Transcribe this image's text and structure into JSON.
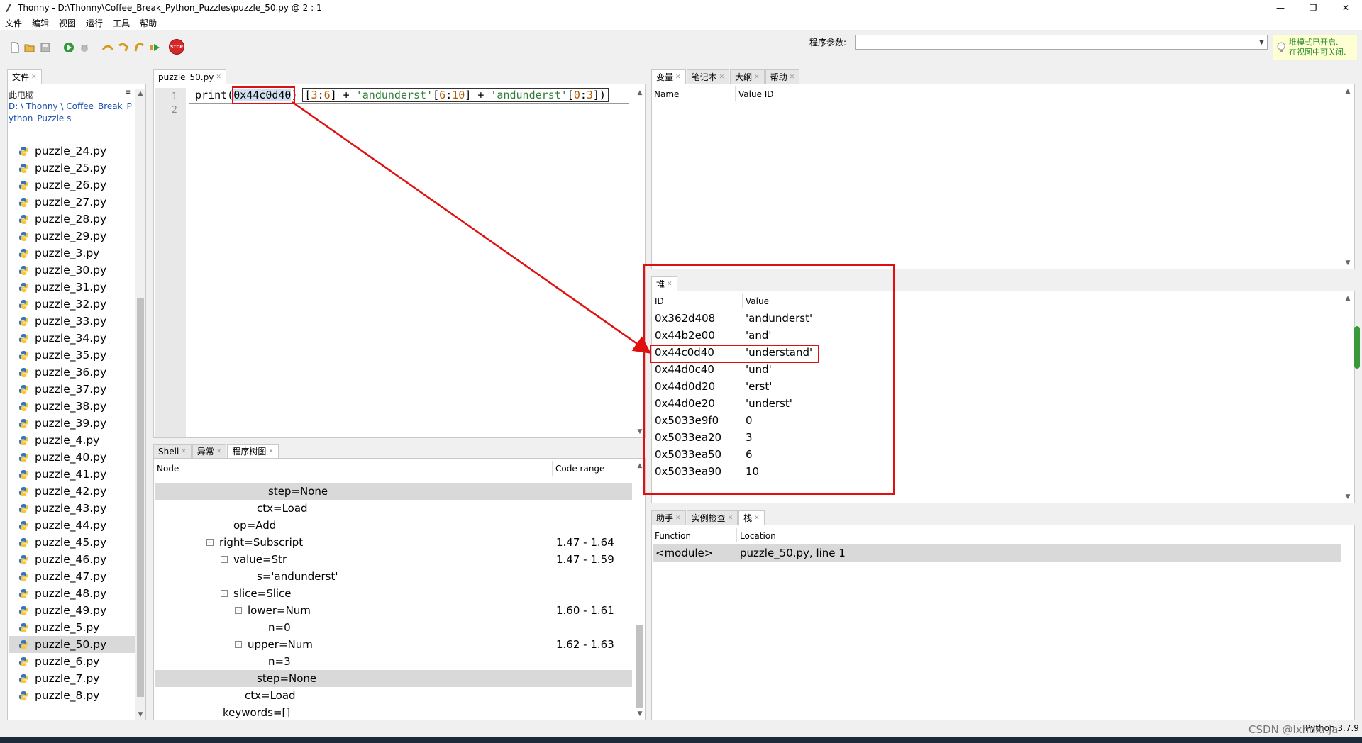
{
  "window": {
    "title": "Thonny  -  D:\\Thonny\\Coffee_Break_Python_Puzzles\\puzzle_50.py  @  2 : 1",
    "min": "—",
    "max": "❐",
    "close": "✕"
  },
  "menu": [
    "文件",
    "编辑",
    "视图",
    "运行",
    "工具",
    "帮助"
  ],
  "toolbar": {
    "args_label": "程序参数:",
    "args_value": "",
    "stop_label": "STOP",
    "notice": "堆模式已开启.\n在视图中可关闭."
  },
  "files": {
    "tab": "文件",
    "pc": "此电脑",
    "path": "D: \\ Thonny \\ Coffee_Break_Python_Puzzle s",
    "items": [
      "puzzle_24.py",
      "puzzle_25.py",
      "puzzle_26.py",
      "puzzle_27.py",
      "puzzle_28.py",
      "puzzle_29.py",
      "puzzle_3.py",
      "puzzle_30.py",
      "puzzle_31.py",
      "puzzle_32.py",
      "puzzle_33.py",
      "puzzle_34.py",
      "puzzle_35.py",
      "puzzle_36.py",
      "puzzle_37.py",
      "puzzle_38.py",
      "puzzle_39.py",
      "puzzle_4.py",
      "puzzle_40.py",
      "puzzle_41.py",
      "puzzle_42.py",
      "puzzle_43.py",
      "puzzle_44.py",
      "puzzle_45.py",
      "puzzle_46.py",
      "puzzle_47.py",
      "puzzle_48.py",
      "puzzle_49.py",
      "puzzle_5.py",
      "puzzle_50.py",
      "puzzle_6.py",
      "puzzle_7.py",
      "puzzle_8.py"
    ],
    "selected": "puzzle_50.py"
  },
  "editor": {
    "tab": "puzzle_50.py",
    "line_numbers": [
      "1",
      "2"
    ],
    "code": {
      "print_open": "print(",
      "highlight": "0x44c0d40",
      "close_paren": ")",
      "rest_1": "[3:6] + 'andunderst'[6:10] + 'andunderst'[0:3])"
    }
  },
  "bottom_tabs": [
    "Shell",
    "异常",
    "程序树图"
  ],
  "tree": {
    "col_node": "Node",
    "col_range": "Code range",
    "rows": [
      {
        "text": "step=None",
        "indent": 160,
        "range": "",
        "toggle": "",
        "gray": true
      },
      {
        "text": "ctx=Load",
        "indent": 144,
        "range": "",
        "toggle": "",
        "gray": false
      },
      {
        "text": "op=Add",
        "indent": 111,
        "range": "",
        "toggle": "",
        "gray": false
      },
      {
        "text": "right=Subscript",
        "indent": 93,
        "range": "1.47  -  1.64",
        "toggle": "⊟",
        "gray": false
      },
      {
        "text": "value=Str",
        "indent": 113,
        "range": "1.47  -  1.59",
        "toggle": "⊟",
        "gray": false
      },
      {
        "text": "s='andunderst'",
        "indent": 144,
        "range": "",
        "toggle": "",
        "gray": false
      },
      {
        "text": "slice=Slice",
        "indent": 113,
        "range": "",
        "toggle": "⊟",
        "gray": false
      },
      {
        "text": "lower=Num",
        "indent": 133,
        "range": "1.60  -  1.61",
        "toggle": "⊟",
        "gray": false
      },
      {
        "text": "n=0",
        "indent": 160,
        "range": "",
        "toggle": "",
        "gray": false
      },
      {
        "text": "upper=Num",
        "indent": 133,
        "range": "1.62  -  1.63",
        "toggle": "⊟",
        "gray": false
      },
      {
        "text": "n=3",
        "indent": 160,
        "range": "",
        "toggle": "",
        "gray": false
      },
      {
        "text": "step=None",
        "indent": 144,
        "range": "",
        "toggle": "",
        "gray": true
      },
      {
        "text": "ctx=Load",
        "indent": 127,
        "range": "",
        "toggle": "",
        "gray": false
      },
      {
        "text": "keywords=[]",
        "indent": 96,
        "range": "",
        "toggle": "",
        "gray": false
      }
    ]
  },
  "vars": {
    "tabs": [
      "变量",
      "笔记本",
      "大纲",
      "帮助"
    ],
    "col_name": "Name",
    "col_id": "Value ID"
  },
  "heap": {
    "tab": "堆",
    "col_id": "ID",
    "col_value": "Value",
    "rows": [
      {
        "id": "0x362d408",
        "value": "'andunderst'"
      },
      {
        "id": "0x44b2e00",
        "value": "'and'"
      },
      {
        "id": "0x44c0d40",
        "value": "'understand'"
      },
      {
        "id": "0x44d0c40",
        "value": "'und'"
      },
      {
        "id": "0x44d0d20",
        "value": "'erst'"
      },
      {
        "id": "0x44d0e20",
        "value": "'underst'"
      },
      {
        "id": "0x5033e9f0",
        "value": "0"
      },
      {
        "id": "0x5033ea20",
        "value": "3"
      },
      {
        "id": "0x5033ea50",
        "value": "6"
      },
      {
        "id": "0x5033ea90",
        "value": "10"
      }
    ]
  },
  "stack": {
    "tabs": [
      "助手",
      "实例检查",
      "栈"
    ],
    "col_function": "Function",
    "col_location": "Location",
    "function": "<module>",
    "location": "puzzle_50.py, line 1"
  },
  "status": {
    "watermark": "CSDN @lxhdxr.ja",
    "python": "Python 3.7.9"
  },
  "colors": {
    "annotation_red": "#e01010",
    "selection_gray": "#d9d9d9",
    "string_green": "#2e7d32",
    "number_orange": "#b35900"
  }
}
